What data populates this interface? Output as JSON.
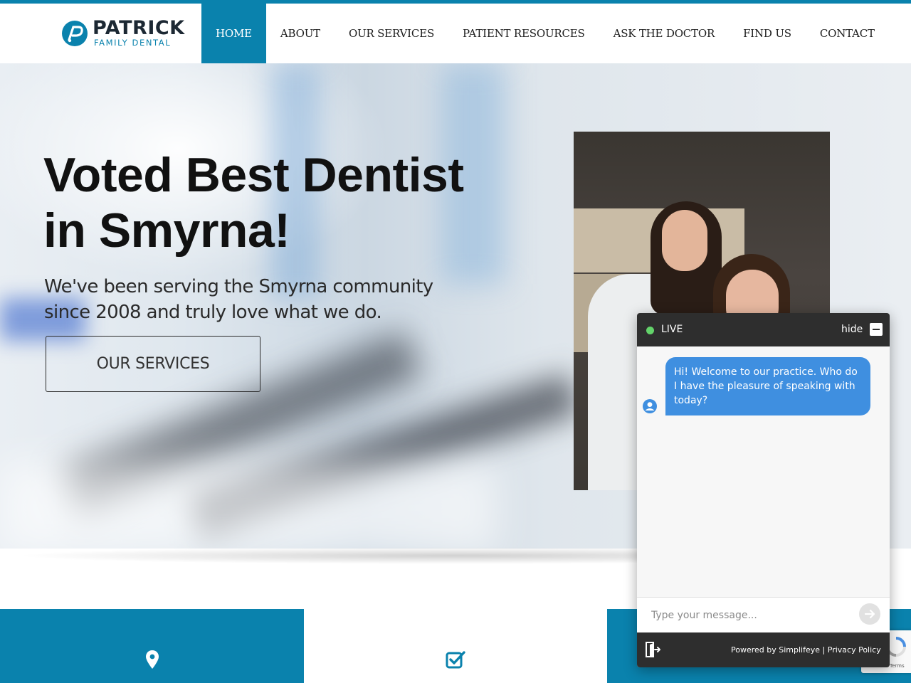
{
  "brand": {
    "name": "PATRICK",
    "tagline": "FAMILY DENTAL",
    "accent": "#0a82ad",
    "dark": "#1c2833"
  },
  "nav": {
    "items": [
      {
        "label": "HOME",
        "active": true
      },
      {
        "label": "ABOUT",
        "active": false
      },
      {
        "label": "OUR SERVICES",
        "active": false
      },
      {
        "label": "PATIENT RESOURCES",
        "active": false
      },
      {
        "label": "ASK THE DOCTOR",
        "active": false
      },
      {
        "label": "FIND US",
        "active": false
      },
      {
        "label": "CONTACT",
        "active": false
      }
    ]
  },
  "hero": {
    "title_line1": "Voted Best Dentist",
    "title_line2": "in Smyrna!",
    "subtitle_line1": "We've been serving the Smyrna community",
    "subtitle_line2": "since 2008 and truly love what we do.",
    "cta_label": "OUR SERVICES"
  },
  "chat": {
    "status": "LIVE",
    "status_color": "#63d36a",
    "hide_label": "hide",
    "welcome_message": "Hi! Welcome to our practice.  Who do I have the pleasure of speaking with today?",
    "bubble_color": "#3f8fe0",
    "input_placeholder": "Type your message...",
    "powered_prefix": "Powered by",
    "powered_brand": "Simplifeye",
    "separator": "|",
    "privacy_label": "Privacy Policy"
  },
  "recaptcha": {
    "terms_label": "Terms"
  },
  "tiles": [
    {
      "icon": "map-pin-icon"
    },
    {
      "icon": "checkbox-icon"
    },
    {
      "icon": "none"
    }
  ]
}
